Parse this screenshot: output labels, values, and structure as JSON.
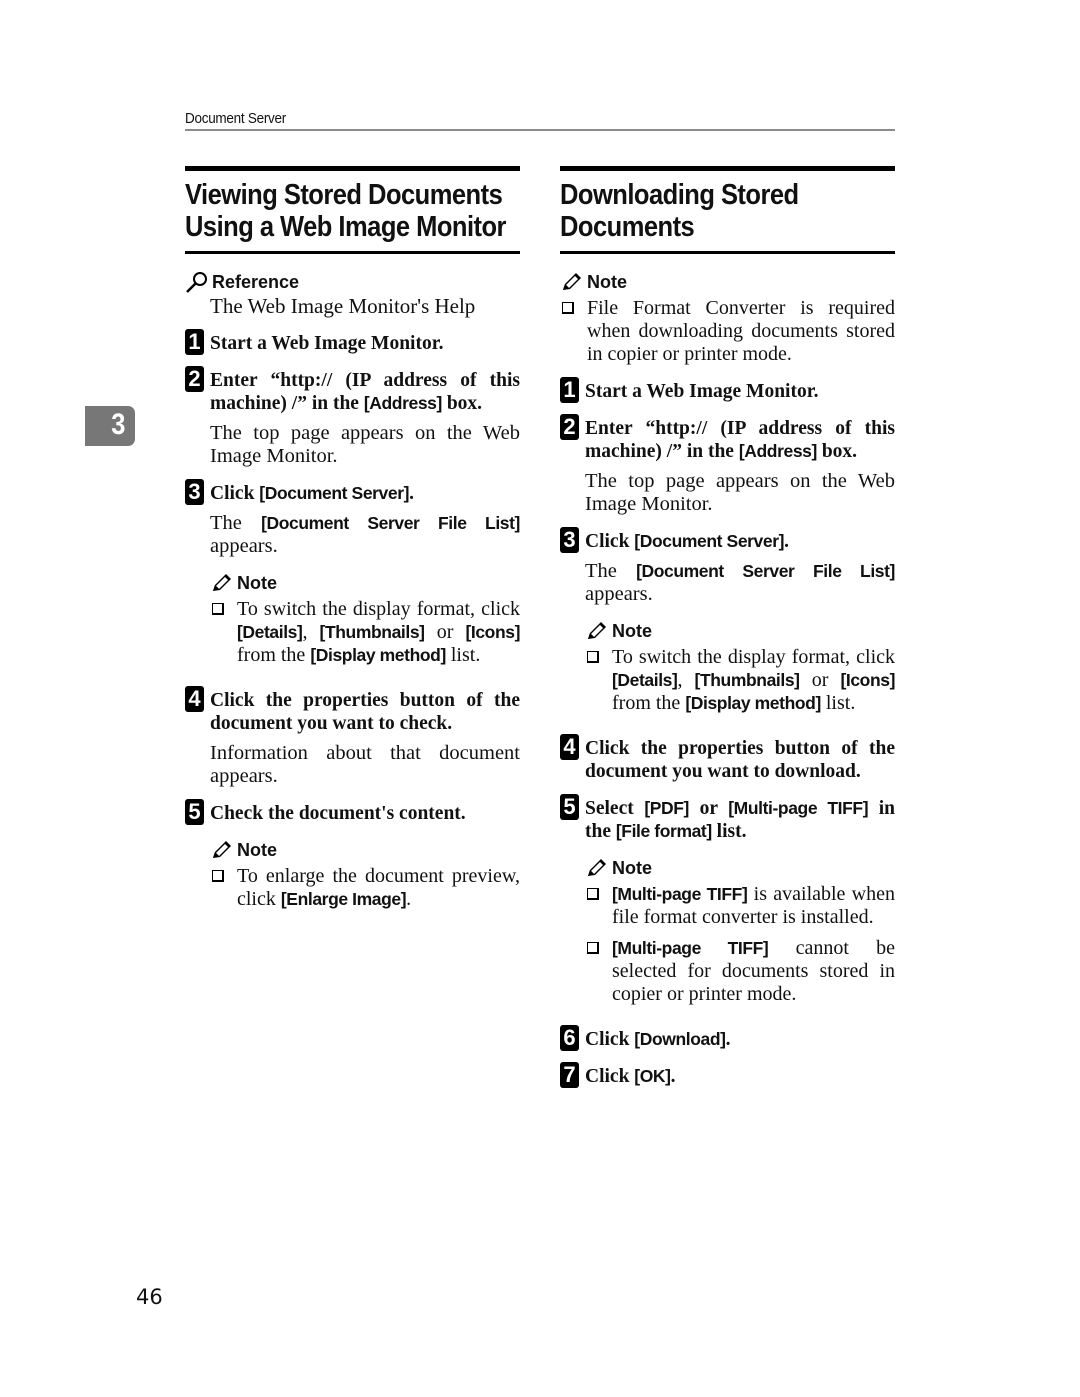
{
  "header": {
    "running_title": "Document Server"
  },
  "chapter_tab": {
    "number": "3"
  },
  "page_number": "46",
  "left_section": {
    "title_line1": "Viewing Stored Documents",
    "title_line2": "Using a Web Image Monitor",
    "reference": {
      "label": "Reference",
      "text": "The Web Image Monitor's Help"
    },
    "steps": [
      {
        "num": "1",
        "title": "Start a Web Image Monitor."
      },
      {
        "num": "2",
        "title_pre": "Enter “http:// (IP address of this machine) /” in the ",
        "title_ui": "[Address]",
        "title_post": " box.",
        "desc": "The top page appears on the Web Image Monitor."
      },
      {
        "num": "3",
        "title_pre": "Click ",
        "title_ui": "[Document Server]",
        "title_post": ".",
        "desc_pre": "The ",
        "desc_ui": "[Document Server File List]",
        "desc_post": " appears.",
        "note": {
          "label": "Note",
          "items": [
            {
              "t1": "To switch the display format, click ",
              "u1": "[Details]",
              "t2": ", ",
              "u2": "[Thumbnails]",
              "t3": " or ",
              "u3": "[Icons]",
              "t4": " from the ",
              "u4": "[Display method]",
              "t5": " list."
            }
          ]
        }
      },
      {
        "num": "4",
        "title": "Click the properties button of the document you want to check.",
        "desc": "Information about that document appears."
      },
      {
        "num": "5",
        "title": "Check the document's content.",
        "note": {
          "label": "Note",
          "items": [
            {
              "t1": "To enlarge the document preview, click ",
              "u1": "[Enlarge Image]",
              "t2": "."
            }
          ]
        }
      }
    ]
  },
  "right_section": {
    "title_line1": "Downloading Stored",
    "title_line2": "Documents",
    "note": {
      "label": "Note",
      "items": [
        {
          "t1": "File Format Converter is required when downloading documents stored in copier or printer mode."
        }
      ]
    },
    "steps": [
      {
        "num": "1",
        "title": "Start a Web Image Monitor."
      },
      {
        "num": "2",
        "title_pre": "Enter “http:// (IP address of this machine) /” in the ",
        "title_ui": "[Address]",
        "title_post": " box.",
        "desc": "The top page appears on the Web Image Monitor."
      },
      {
        "num": "3",
        "title_pre": "Click ",
        "title_ui": "[Document Server]",
        "title_post": ".",
        "desc_pre": "The ",
        "desc_ui": "[Document Server File List]",
        "desc_post": " appears.",
        "note": {
          "label": "Note",
          "items": [
            {
              "t1": "To switch the display format, click ",
              "u1": "[Details]",
              "t2": ", ",
              "u2": "[Thumbnails]",
              "t3": " or ",
              "u3": "[Icons]",
              "t4": " from the ",
              "u4": "[Display method]",
              "t5": " list."
            }
          ]
        }
      },
      {
        "num": "4",
        "title": "Click the properties button of the document you want to download."
      },
      {
        "num": "5",
        "title_pre": "Select ",
        "title_ui": "[PDF]",
        "title_mid": " or ",
        "title_ui2": "[Multi-page TIFF]",
        "title_mid2": " in the ",
        "title_ui3": "[File format]",
        "title_post": " list.",
        "note": {
          "label": "Note",
          "items": [
            {
              "u1": "[Multi-page TIFF]",
              "t1": " is available when file format converter is installed."
            },
            {
              "u1": "[Multi-page TIFF]",
              "t1": " cannot be selected for documents stored in copier or printer mode."
            }
          ]
        }
      },
      {
        "num": "6",
        "title_pre": "Click ",
        "title_ui": "[Download]",
        "title_post": "."
      },
      {
        "num": "7",
        "title_pre": "Click ",
        "title_ui": "[OK]",
        "title_post": "."
      }
    ]
  }
}
